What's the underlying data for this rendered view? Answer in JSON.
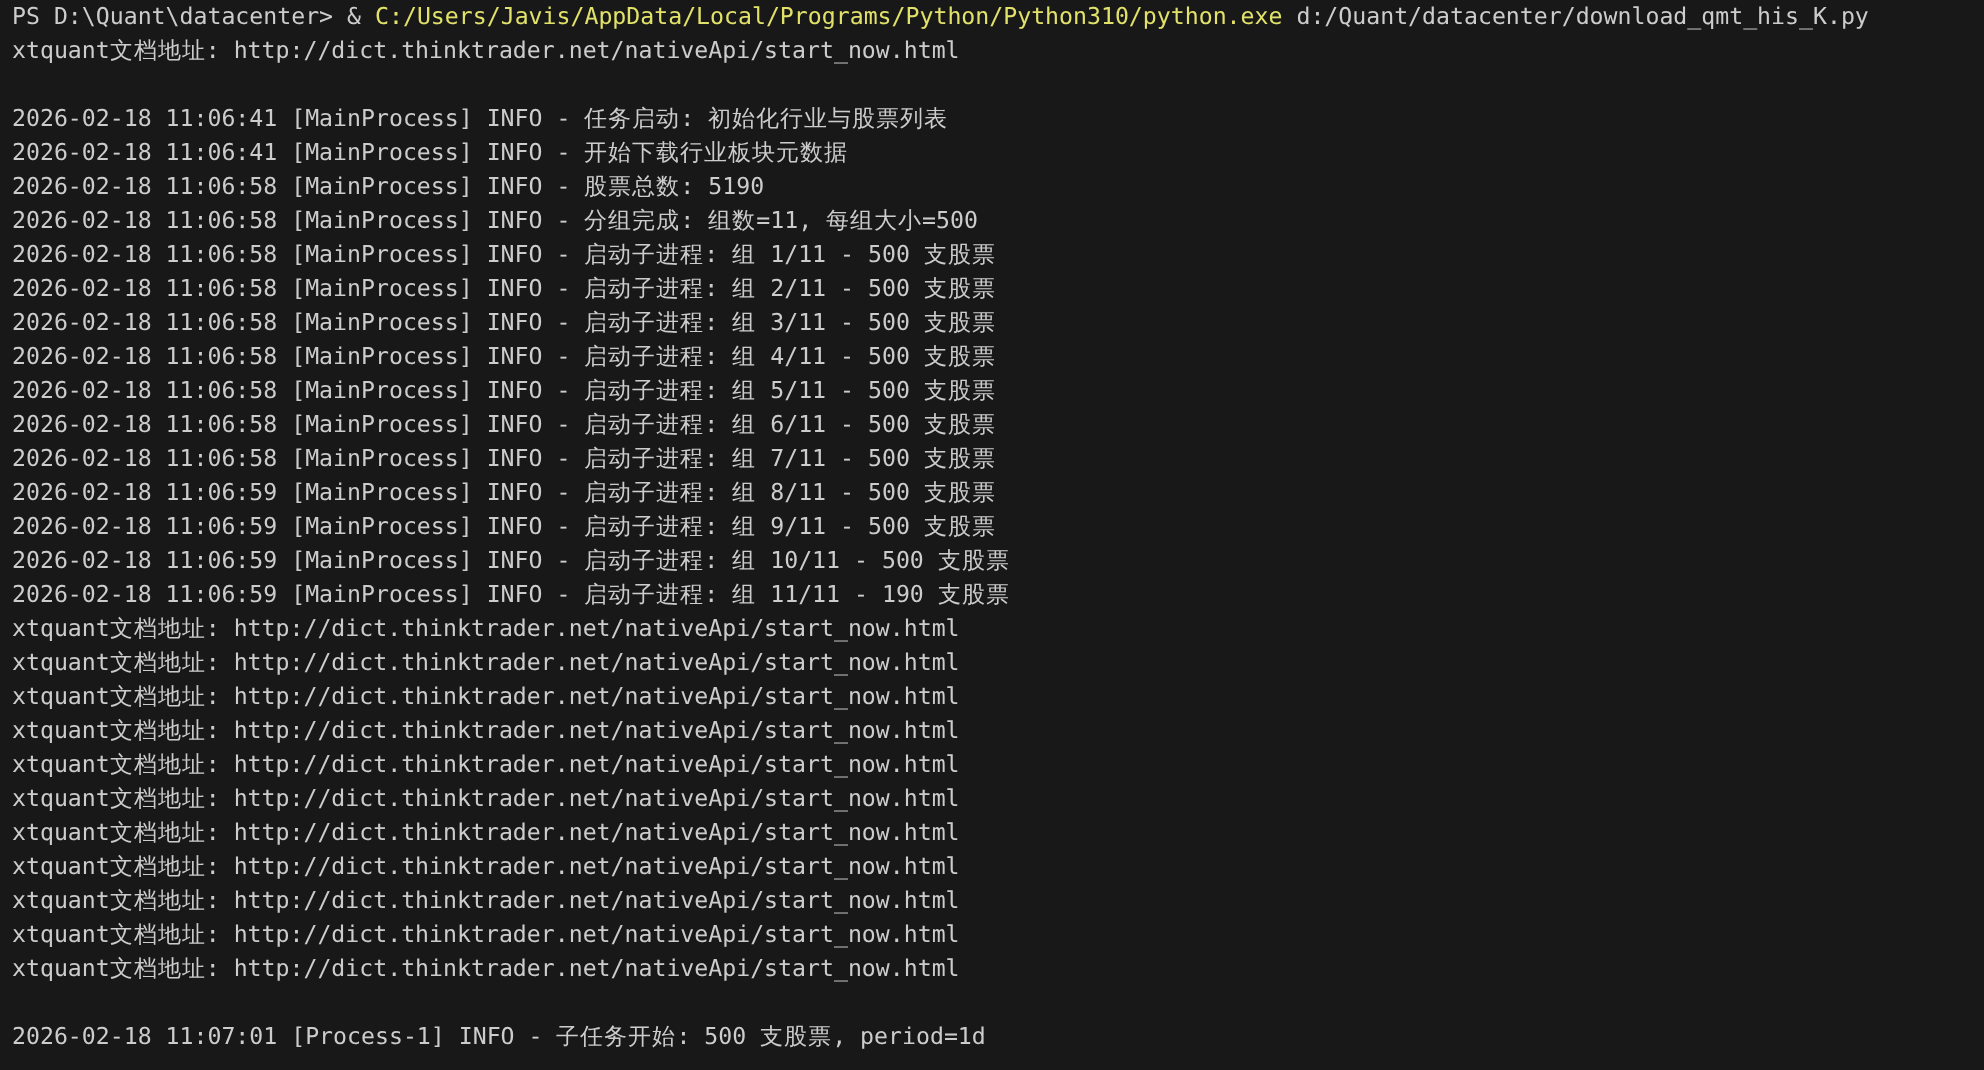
{
  "terminal": {
    "prompt": {
      "path": "PS D:\\Quant\\datacenter> &",
      "command": "C:/Users/Javis/AppData/Local/Programs/Python/Python310/python.exe",
      "argument": "d:/Quant/datacenter/download_qmt_his_K.py"
    },
    "lines": [
      {
        "kind": "text",
        "text": "xtquant文档地址: http://dict.thinktrader.net/nativeApi/start_now.html"
      },
      {
        "kind": "blank"
      },
      {
        "kind": "text",
        "text": "2026-02-18 11:06:41 [MainProcess] INFO - 任务启动: 初始化行业与股票列表"
      },
      {
        "kind": "text",
        "text": "2026-02-18 11:06:41 [MainProcess] INFO - 开始下载行业板块元数据"
      },
      {
        "kind": "text",
        "text": "2026-02-18 11:06:58 [MainProcess] INFO - 股票总数: 5190"
      },
      {
        "kind": "text",
        "text": "2026-02-18 11:06:58 [MainProcess] INFO - 分组完成: 组数=11, 每组大小=500"
      },
      {
        "kind": "text",
        "text": "2026-02-18 11:06:58 [MainProcess] INFO - 启动子进程: 组 1/11 - 500 支股票"
      },
      {
        "kind": "text",
        "text": "2026-02-18 11:06:58 [MainProcess] INFO - 启动子进程: 组 2/11 - 500 支股票"
      },
      {
        "kind": "text",
        "text": "2026-02-18 11:06:58 [MainProcess] INFO - 启动子进程: 组 3/11 - 500 支股票"
      },
      {
        "kind": "text",
        "text": "2026-02-18 11:06:58 [MainProcess] INFO - 启动子进程: 组 4/11 - 500 支股票"
      },
      {
        "kind": "text",
        "text": "2026-02-18 11:06:58 [MainProcess] INFO - 启动子进程: 组 5/11 - 500 支股票"
      },
      {
        "kind": "text",
        "text": "2026-02-18 11:06:58 [MainProcess] INFO - 启动子进程: 组 6/11 - 500 支股票"
      },
      {
        "kind": "text",
        "text": "2026-02-18 11:06:58 [MainProcess] INFO - 启动子进程: 组 7/11 - 500 支股票"
      },
      {
        "kind": "text",
        "text": "2026-02-18 11:06:59 [MainProcess] INFO - 启动子进程: 组 8/11 - 500 支股票"
      },
      {
        "kind": "text",
        "text": "2026-02-18 11:06:59 [MainProcess] INFO - 启动子进程: 组 9/11 - 500 支股票"
      },
      {
        "kind": "text",
        "text": "2026-02-18 11:06:59 [MainProcess] INFO - 启动子进程: 组 10/11 - 500 支股票"
      },
      {
        "kind": "text",
        "text": "2026-02-18 11:06:59 [MainProcess] INFO - 启动子进程: 组 11/11 - 190 支股票"
      },
      {
        "kind": "text",
        "text": "xtquant文档地址: http://dict.thinktrader.net/nativeApi/start_now.html"
      },
      {
        "kind": "text",
        "text": "xtquant文档地址: http://dict.thinktrader.net/nativeApi/start_now.html"
      },
      {
        "kind": "text",
        "text": "xtquant文档地址: http://dict.thinktrader.net/nativeApi/start_now.html"
      },
      {
        "kind": "text",
        "text": "xtquant文档地址: http://dict.thinktrader.net/nativeApi/start_now.html"
      },
      {
        "kind": "text",
        "text": "xtquant文档地址: http://dict.thinktrader.net/nativeApi/start_now.html"
      },
      {
        "kind": "text",
        "text": "xtquant文档地址: http://dict.thinktrader.net/nativeApi/start_now.html"
      },
      {
        "kind": "text",
        "text": "xtquant文档地址: http://dict.thinktrader.net/nativeApi/start_now.html"
      },
      {
        "kind": "text",
        "text": "xtquant文档地址: http://dict.thinktrader.net/nativeApi/start_now.html"
      },
      {
        "kind": "text",
        "text": "xtquant文档地址: http://dict.thinktrader.net/nativeApi/start_now.html"
      },
      {
        "kind": "text",
        "text": "xtquant文档地址: http://dict.thinktrader.net/nativeApi/start_now.html"
      },
      {
        "kind": "text",
        "text": "xtquant文档地址: http://dict.thinktrader.net/nativeApi/start_now.html"
      },
      {
        "kind": "blank"
      },
      {
        "kind": "text",
        "text": "2026-02-18 11:07:01 [Process-1] INFO - 子任务开始: 500 支股票, period=1d"
      }
    ]
  }
}
